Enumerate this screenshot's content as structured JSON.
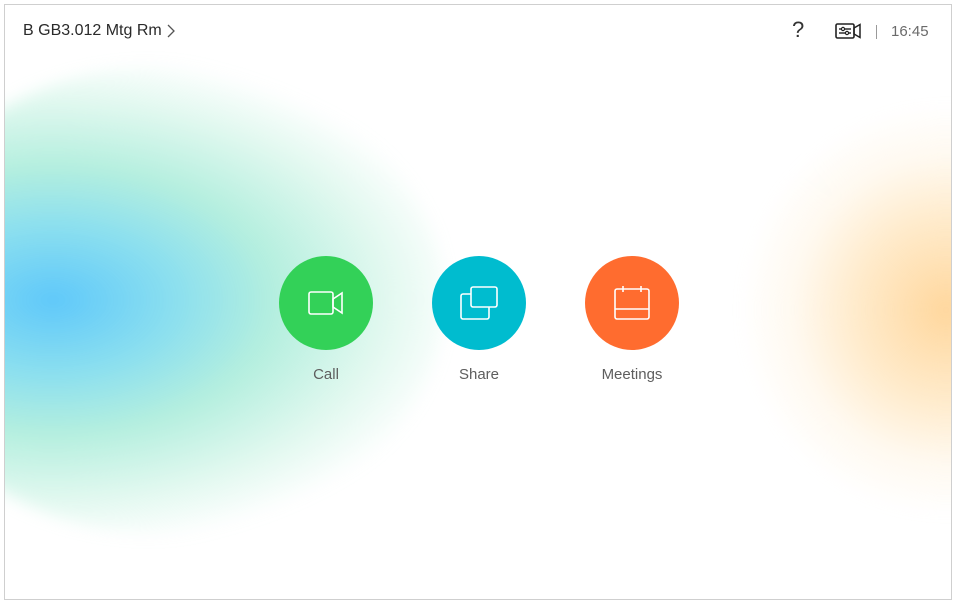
{
  "header": {
    "room_name": "B GB3.012 Mtg Rm",
    "help_symbol": "?",
    "time": "16:45"
  },
  "icons": {
    "room_chevron": "chevron-right-icon",
    "help": "help-icon",
    "camera_settings": "camera-settings-icon",
    "call": "video-camera-icon",
    "share": "share-screen-icon",
    "meetings": "calendar-icon"
  },
  "actions": [
    {
      "label": "Call",
      "color": "#33d158"
    },
    {
      "label": "Share",
      "color": "#00bccf"
    },
    {
      "label": "Meetings",
      "color": "#ff6c2f"
    }
  ],
  "colors": {
    "glow_left": "#56c5fa",
    "glow_mid": "#8ce6cd",
    "glow_right": "#ffd08c"
  }
}
